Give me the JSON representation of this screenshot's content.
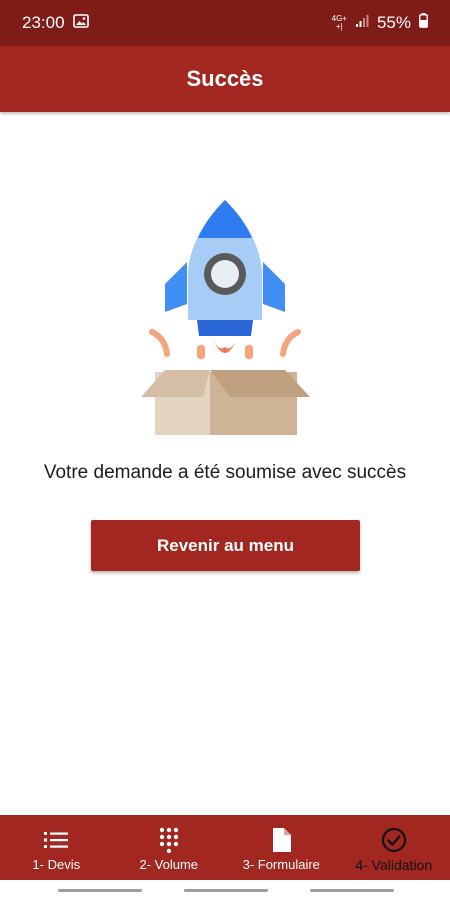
{
  "status_bar": {
    "time": "23:00",
    "network_top": "4G+",
    "network_bottom": "+|",
    "battery_percent": "55%",
    "background": "#7f1c17"
  },
  "app_bar": {
    "title": "Succès",
    "background": "#a32721"
  },
  "content": {
    "illustration_icon": "rocket-launch-from-box",
    "message": "Votre demande a été soumise avec succès",
    "button_label": "Revenir au menu"
  },
  "bottom_nav": {
    "items": [
      {
        "label": "1- Devis",
        "icon": "list-icon",
        "active": false
      },
      {
        "label": "2- Volume",
        "icon": "dial-pad-icon",
        "active": false
      },
      {
        "label": "3- Formulaire",
        "icon": "document-icon",
        "active": false
      },
      {
        "label": "4- Validation",
        "icon": "check-circle-icon",
        "active": true
      }
    ],
    "active_color": "#111111",
    "inactive_color": "#ffffff"
  }
}
